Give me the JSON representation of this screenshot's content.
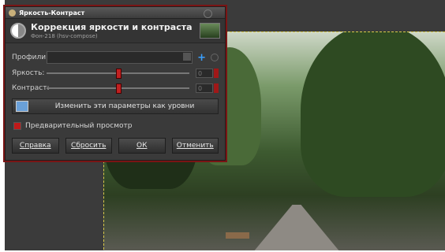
{
  "window": {
    "title": "Яркость-Контраст"
  },
  "header": {
    "title": "Коррекция яркости и контраста",
    "subtitle": "Фон-218 (hsv-compose)"
  },
  "presets": {
    "label": "Профили:",
    "value": ""
  },
  "brightness": {
    "label": "Яркость:",
    "value": "0",
    "level": 0.5
  },
  "contrast": {
    "label": "Контраст:",
    "value": "0",
    "level": 0.5
  },
  "levels_button": {
    "label": "Изменить эти параметры как уровни"
  },
  "preview": {
    "label": "Предварительный просмотр",
    "checked": true
  },
  "buttons": {
    "help": "Справка",
    "reset": "Сбросить",
    "ok": "ОК",
    "cancel": "Отменить"
  },
  "icons": [
    "contrast-icon",
    "preview-thumbnail",
    "add-icon",
    "remove-icon",
    "levels-icon"
  ],
  "colors": {
    "accent": "#c01a1a",
    "dialog_bg": "#3a3a3a",
    "selection": "#d7c84a"
  }
}
